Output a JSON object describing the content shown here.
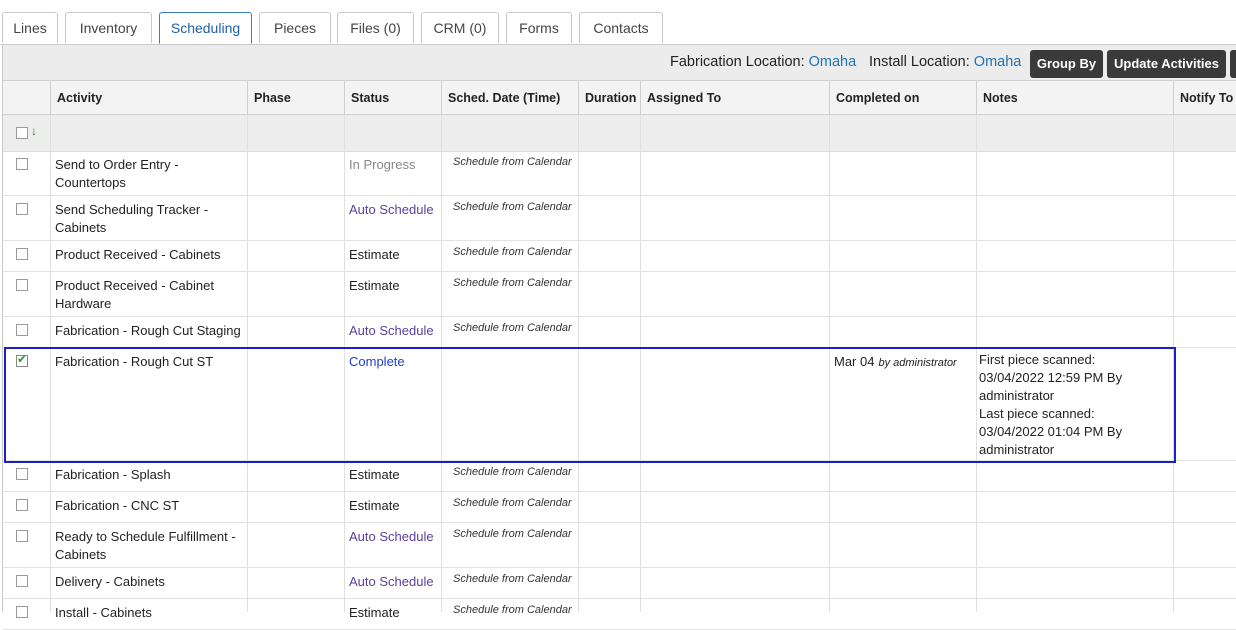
{
  "tabs": [
    "Lines",
    "Inventory",
    "Scheduling",
    "Pieces",
    "Files (0)",
    "CRM (0)",
    "Forms",
    "Contacts"
  ],
  "active_tab": "Scheduling",
  "toolbar": {
    "fab_label": "Fabrication Location:",
    "fab_value": "Omaha",
    "install_label": "Install Location:",
    "install_value": "Omaha",
    "group_by": "Group By",
    "update_activities": "Update Activities"
  },
  "columns": [
    "Activity",
    "Phase",
    "Status",
    "Sched. Date (Time)",
    "Duration",
    "Assigned To",
    "Completed on",
    "Notes",
    "Notify To"
  ],
  "rows": [
    {
      "activity": [
        "Send to Order Entry -",
        "Countertops"
      ],
      "status": "In Progress",
      "status_kind": "prog",
      "sched": "Schedule from Calendar",
      "checked": false
    },
    {
      "activity": [
        "Send Scheduling Tracker -",
        "Cabinets"
      ],
      "status": "Auto Schedule",
      "status_kind": "auto",
      "sched": "Schedule from Calendar",
      "checked": false
    },
    {
      "activity": [
        "Product Received - Cabinets"
      ],
      "status": "Estimate",
      "status_kind": "est",
      "sched": "Schedule from Calendar",
      "checked": false
    },
    {
      "activity": [
        "Product Received - Cabinet",
        "Hardware"
      ],
      "status": "Estimate",
      "status_kind": "est",
      "sched": "Schedule from Calendar",
      "checked": false
    },
    {
      "activity": [
        "Fabrication - Rough Cut Staging"
      ],
      "status": "Auto Schedule",
      "status_kind": "auto",
      "sched": "Schedule from Calendar",
      "checked": false
    },
    {
      "activity": [
        "Fabrication - Rough Cut ST"
      ],
      "status": "Complete",
      "status_kind": "comp",
      "sched": "",
      "checked": true,
      "completed_date": "Mar 04",
      "completed_by": "by administrator",
      "notes": [
        "First piece scanned:",
        "03/04/2022 12:59 PM By",
        "administrator",
        "Last piece scanned:",
        "03/04/2022 01:04 PM By",
        "administrator"
      ]
    },
    {
      "activity": [
        "Fabrication - Splash"
      ],
      "status": "Estimate",
      "status_kind": "est",
      "sched": "Schedule from Calendar",
      "checked": false
    },
    {
      "activity": [
        "Fabrication - CNC ST"
      ],
      "status": "Estimate",
      "status_kind": "est",
      "sched": "Schedule from Calendar",
      "checked": false
    },
    {
      "activity": [
        "Ready to Schedule Fulfillment -",
        "Cabinets"
      ],
      "status": "Auto Schedule",
      "status_kind": "auto",
      "sched": "Schedule from Calendar",
      "checked": false
    },
    {
      "activity": [
        "Delivery - Cabinets"
      ],
      "status": "Auto Schedule",
      "status_kind": "auto",
      "sched": "Schedule from Calendar",
      "checked": false
    },
    {
      "activity": [
        "Install - Cabinets"
      ],
      "status": "Estimate",
      "status_kind": "est",
      "sched": "Schedule from Calendar",
      "checked": false
    }
  ]
}
